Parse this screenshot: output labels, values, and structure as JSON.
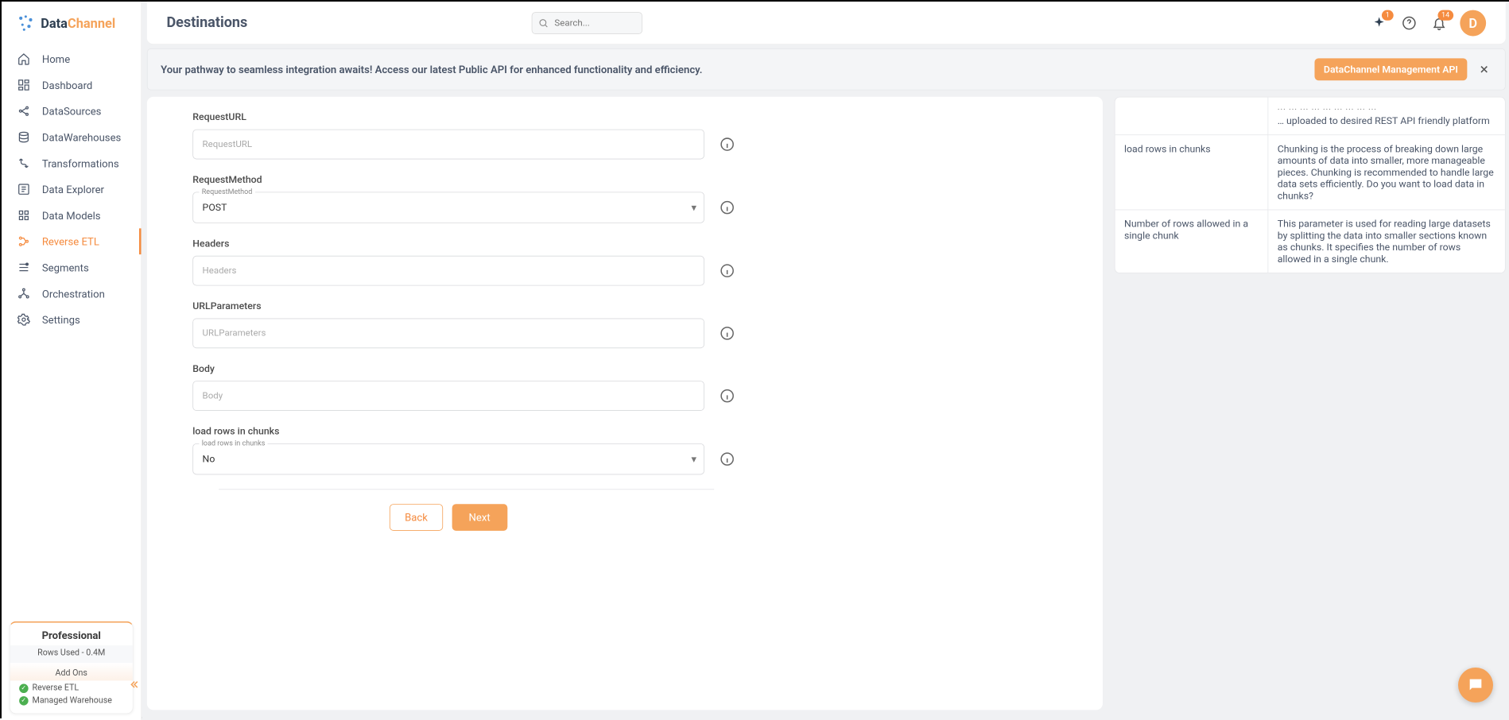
{
  "brand": {
    "name_a": "Data",
    "name_b": "Channel"
  },
  "nav": [
    {
      "label": "Home",
      "icon": "home"
    },
    {
      "label": "Dashboard",
      "icon": "dashboard"
    },
    {
      "label": "DataSources",
      "icon": "datasources"
    },
    {
      "label": "DataWarehouses",
      "icon": "warehouse"
    },
    {
      "label": "Transformations",
      "icon": "transform"
    },
    {
      "label": "Data Explorer",
      "icon": "explorer"
    },
    {
      "label": "Data Models",
      "icon": "models"
    },
    {
      "label": "Reverse ETL",
      "icon": "reverse-etl",
      "active": true
    },
    {
      "label": "Segments",
      "icon": "segments"
    },
    {
      "label": "Orchestration",
      "icon": "orchestration"
    },
    {
      "label": "Settings",
      "icon": "settings"
    }
  ],
  "plan": {
    "title": "Professional",
    "rows": "Rows Used - 0.4M",
    "addons_title": "Add Ons",
    "items": [
      "Reverse ETL",
      "Managed Warehouse"
    ]
  },
  "header": {
    "title": "Destinations",
    "search_placeholder": "Search...",
    "sparkle_badge": "1",
    "bell_badge": "14",
    "avatar_letter": "D"
  },
  "banner": {
    "text": "Your pathway to seamless integration awaits! Access our latest Public API for enhanced functionality and efficiency.",
    "btn": "DataChannel Management API"
  },
  "form": {
    "request_url": {
      "label": "RequestURL",
      "placeholder": "RequestURL"
    },
    "request_method": {
      "label": "RequestMethod",
      "float": "RequestMethod",
      "value": "POST"
    },
    "headers": {
      "label": "Headers",
      "placeholder": "Headers"
    },
    "url_params": {
      "label": "URLParameters",
      "placeholder": "URLParameters"
    },
    "body": {
      "label": "Body",
      "placeholder": "Body"
    },
    "load_chunks": {
      "label": "load rows in chunks",
      "float": "load rows in chunks",
      "value": "No"
    },
    "back": "Back",
    "next": "Next"
  },
  "help": [
    {
      "k": "",
      "v_truncated": true,
      "v": "… uploaded to desired REST API friendly platform"
    },
    {
      "k": "load rows in chunks",
      "v": "Chunking is the process of breaking down large amounts of data into smaller, more manageable pieces. Chunking is recommended to handle large data sets efficiently. Do you want to load data in chunks?"
    },
    {
      "k": "Number of rows allowed in a single chunk",
      "v": "This parameter is used for reading large datasets by splitting the data into smaller sections known as chunks. It specifies the number of rows allowed in a single chunk."
    }
  ]
}
